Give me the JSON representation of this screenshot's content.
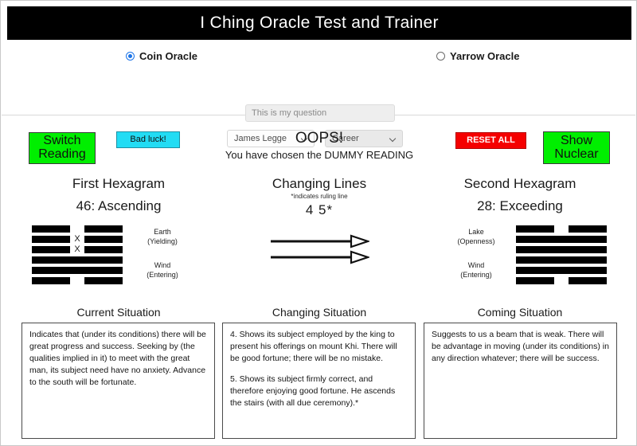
{
  "header": {
    "title": "I Ching Oracle Test and Trainer"
  },
  "controls": {
    "oracle_mode": {
      "coin_label": "Coin Oracle",
      "coin_selected": true,
      "yarrow_label": "Yarrow Oracle",
      "yarrow_selected": false
    },
    "question": {
      "value": "",
      "placeholder": "This is my question"
    },
    "translator_select": {
      "selected": "James Legge"
    },
    "topic_select": {
      "selected": "Career"
    }
  },
  "toolbar": {
    "switch_reading_label": "Switch\nReading",
    "switch_reading_line1": "Switch",
    "switch_reading_line2": "Reading",
    "bad_luck_label": "Bad luck!",
    "reset_all_label": "RESET ALL",
    "show_nuclear_line1": "Show",
    "show_nuclear_line2": "Nuclear",
    "colors": {
      "green": "#00ef00",
      "cyan": "#22dcf4",
      "red": "#f50000",
      "accent_blue": "#1a73e8"
    }
  },
  "status": {
    "headline": "OOPS!",
    "detail": "You have chosen the DUMMY READING"
  },
  "columns": {
    "first": {
      "heading": "First Hexagram",
      "subtitle": "46:  Ascending",
      "upper_trigram_name": "Earth",
      "upper_trigram_attr": "(Yielding)",
      "lower_trigram_name": "Wind",
      "lower_trigram_attr": "(Entering)",
      "lines": [
        {
          "type": "broken",
          "mark": ""
        },
        {
          "type": "broken",
          "mark": "X"
        },
        {
          "type": "broken",
          "mark": "X"
        },
        {
          "type": "solid",
          "mark": ""
        },
        {
          "type": "solid",
          "mark": ""
        },
        {
          "type": "broken",
          "mark": ""
        }
      ]
    },
    "changing": {
      "heading": "Changing Lines",
      "note": "*indicates ruling line",
      "values": "4  5*",
      "arrow_count": 2
    },
    "second": {
      "heading": "Second Hexagram",
      "subtitle": "28:  Exceeding",
      "upper_trigram_name": "Lake",
      "upper_trigram_attr": "(Openness)",
      "lower_trigram_name": "Wind",
      "lower_trigram_attr": "(Entering)",
      "lines": [
        {
          "type": "broken",
          "mark": ""
        },
        {
          "type": "solid",
          "mark": ""
        },
        {
          "type": "solid",
          "mark": ""
        },
        {
          "type": "solid",
          "mark": ""
        },
        {
          "type": "solid",
          "mark": ""
        },
        {
          "type": "broken",
          "mark": ""
        }
      ]
    }
  },
  "readings": {
    "current": {
      "title": "Current Situation",
      "paragraph_1": "Indicates that (under its conditions) there will be great progress and success. Seeking by (the qualities implied in it) to meet with the great man, its subject need have no anxiety. Advance to the south will be fortunate."
    },
    "changing": {
      "title": "Changing Situation",
      "paragraph_1": "4. Shows its subject employed by the king to present his offerings on mount Khi. There will be good fortune; there will be no mistake.",
      "paragraph_2": "5. Shows its subject firmly correct, and therefore enjoying good fortune. He ascends the stairs (with all due ceremony).*"
    },
    "coming": {
      "title": "Coming Situation",
      "paragraph_1": "Suggests to us a beam that is weak. There will be advantage in moving (under its conditions) in any direction whatever; there will be success."
    }
  }
}
